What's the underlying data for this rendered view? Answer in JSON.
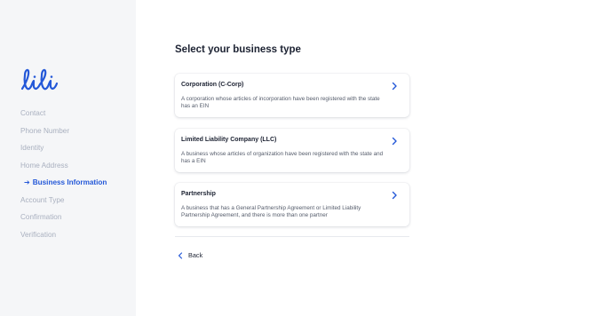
{
  "brand": {
    "logo_text": "lili",
    "accent_color": "#2458d8"
  },
  "sidebar": {
    "items": [
      {
        "label": "Contact",
        "active": false
      },
      {
        "label": "Phone Number",
        "active": false
      },
      {
        "label": "Identity",
        "active": false
      },
      {
        "label": "Home Address",
        "active": false
      },
      {
        "label": "Business Information",
        "active": true
      },
      {
        "label": "Account Type",
        "active": false
      },
      {
        "label": "Confirmation",
        "active": false
      },
      {
        "label": "Verification",
        "active": false
      }
    ],
    "active_icon": "arrow-right-icon"
  },
  "main": {
    "title": "Select your business type",
    "options": [
      {
        "title": "Corporation (C-Corp)",
        "description": "A corporation whose articles of incorporation have been registered with the state has an EIN",
        "icon": "chevron-right-icon"
      },
      {
        "title": "Limited Liability Company (LLC)",
        "description": "A business whose articles of organization have been registered with the state and has a EIN",
        "icon": "chevron-right-icon"
      },
      {
        "title": "Partnership",
        "description": "A business that has a General Partnership Agreement or Limited Liability Partnership Agreement, and there is more than one partner",
        "icon": "chevron-right-icon"
      }
    ],
    "back_label": "Back",
    "back_icon": "chevron-left-icon"
  }
}
